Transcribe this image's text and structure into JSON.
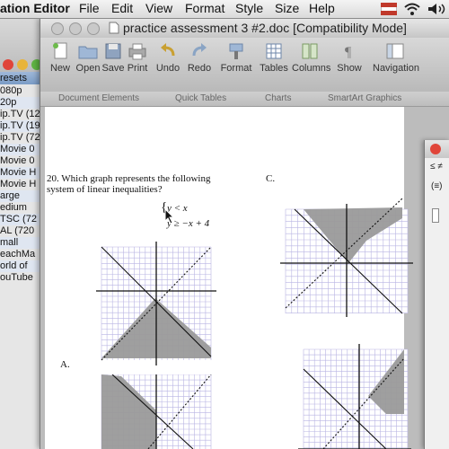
{
  "menubar": {
    "items": [
      "ation Editor",
      "File",
      "Edit",
      "View",
      "Format",
      "Style",
      "Size",
      "Help"
    ]
  },
  "sidebar": {
    "header": "resets",
    "items": [
      "080p",
      "20p",
      "ip.TV (128",
      "ip.TV (192",
      "ip.TV (720",
      "Movie 0",
      "Movie 0",
      "Movie H",
      "Movie H",
      "arge",
      "edium",
      "TSC (72",
      "AL (720",
      "mall",
      "eachMa",
      "orld of",
      "ouTube"
    ]
  },
  "window": {
    "title": "practice assessment 3 #2.doc [Compatibility Mode]"
  },
  "toolbar": {
    "buttons": [
      "New",
      "Open",
      "Save",
      "Print",
      "Undo",
      "Redo",
      "Format",
      "Tables",
      "Columns",
      "Show",
      "Navigation"
    ]
  },
  "ribbon": {
    "tabs": [
      "Document Elements",
      "Quick Tables",
      "Charts",
      "SmartArt Graphics"
    ]
  },
  "document": {
    "question_line1": "20. Which graph represents the following",
    "question_line2": "system of linear inequalities?",
    "ineq1": "y < x",
    "ineq2": "y ≥ −x + 4",
    "option_a": "A.",
    "option_c": "C."
  },
  "panel": {
    "symbols": "≤ ≠",
    "field": "(≡)"
  },
  "colors": {
    "shade": "#9a9a9a",
    "grid": "#b9b5e3",
    "axis": "#111111"
  }
}
